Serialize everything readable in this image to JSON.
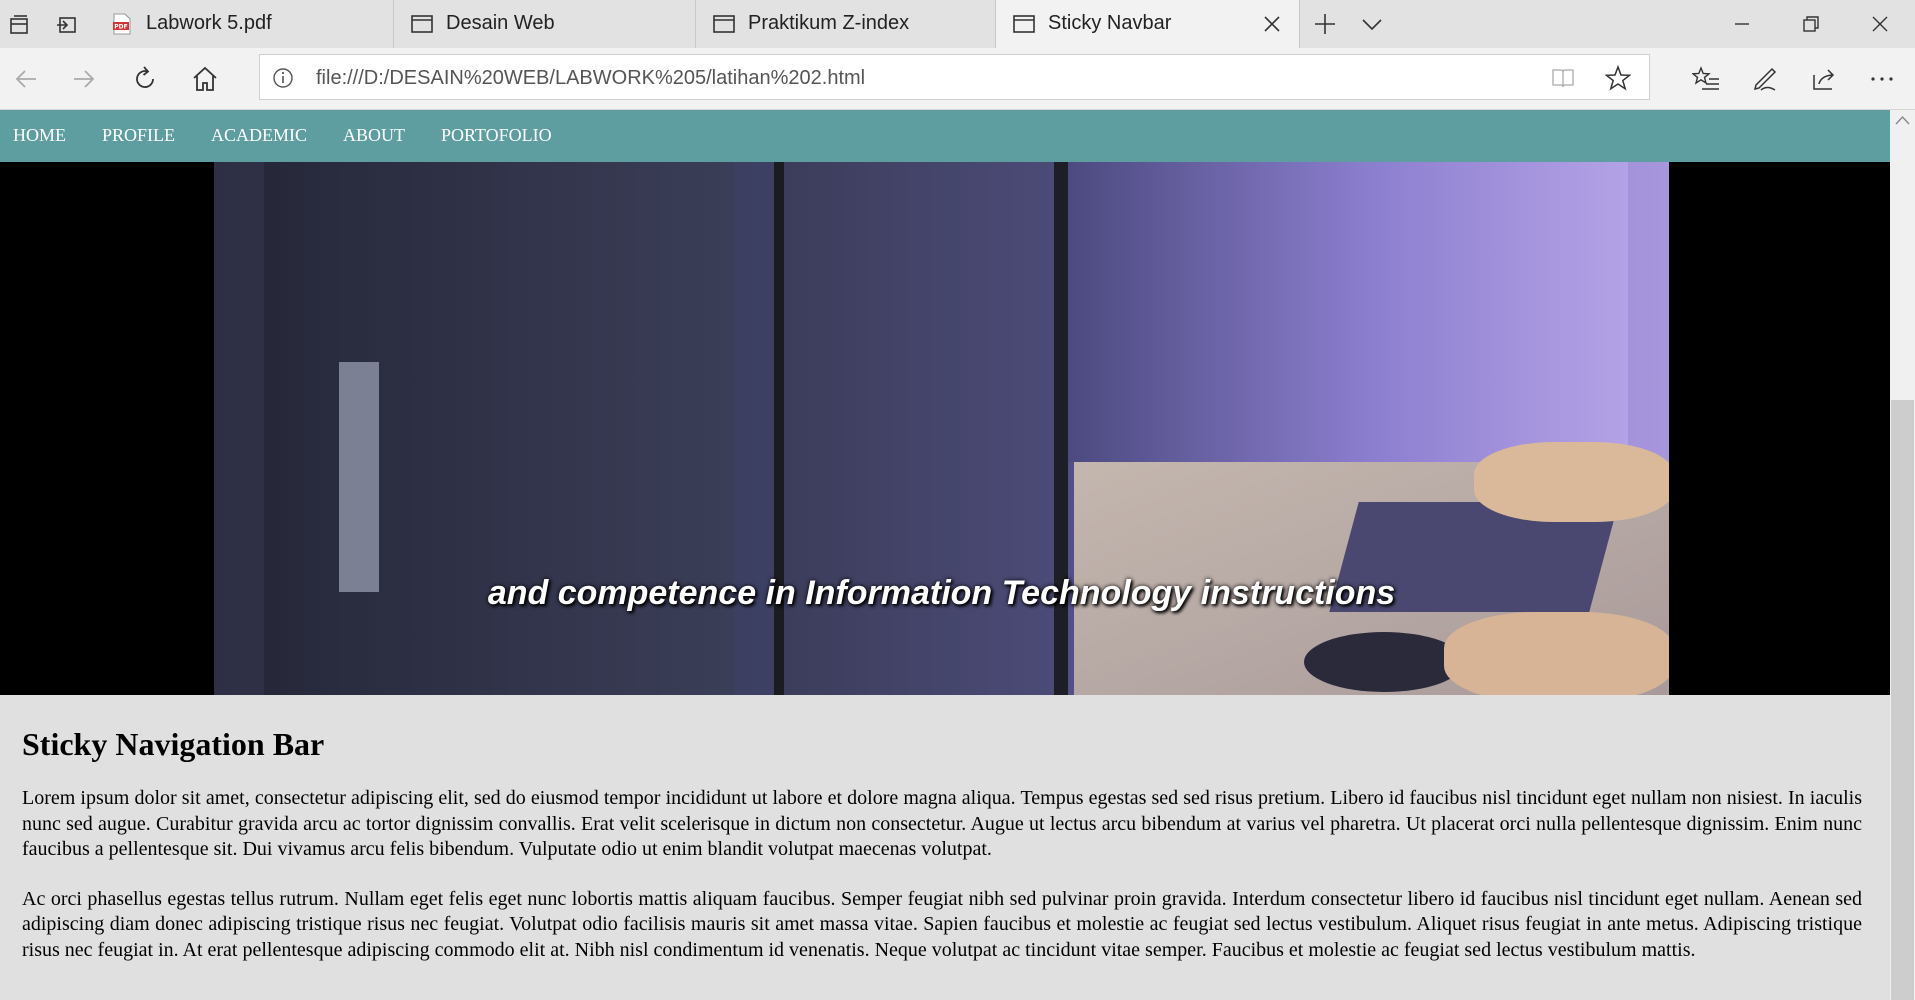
{
  "browser": {
    "tabs": [
      {
        "label": "Labwork 5.pdf",
        "icon": "pdf-icon",
        "active": false
      },
      {
        "label": "Desain Web",
        "icon": "page-icon",
        "active": false
      },
      {
        "label": "Praktikum Z-index",
        "icon": "page-icon",
        "active": false
      },
      {
        "label": "Sticky Navbar",
        "icon": "page-icon",
        "active": true
      }
    ],
    "address": {
      "url": "file:///D:/DESAIN%20WEB/LABWORK%205/latihan%202.html"
    },
    "accent_pdf": "#d13438"
  },
  "page": {
    "nav": {
      "color": "#5f9ea0",
      "links": [
        "HOME",
        "PROFILE",
        "ACADEMIC",
        "ABOUT",
        "PORTOFOLIO"
      ]
    },
    "video": {
      "caption": "and competence in Information Technology instructions"
    },
    "heading": "Sticky Navigation Bar",
    "paragraphs": [
      "Lorem ipsum dolor sit amet, consectetur adipiscing elit, sed do eiusmod tempor incididunt ut labore et dolore magna aliqua. Tempus egestas sed sed risus pretium. Libero id faucibus nisl tincidunt eget nullam non nisiest. In iaculis nunc sed augue. Curabitur gravida arcu ac tortor dignissim convallis. Erat velit scelerisque in dictum non consectetur. Augue ut lectus arcu bibendum at varius vel pharetra. Ut placerat orci nulla pellentesque dignissim. Enim nunc faucibus a pellentesque sit. Dui vivamus arcu felis bibendum. Vulputate odio ut enim blandit volutpat maecenas volutpat.",
      "Ac orci phasellus egestas tellus rutrum. Nullam eget felis eget nunc lobortis mattis aliquam faucibus. Semper feugiat nibh sed pulvinar proin gravida. Interdum consectetur libero id faucibus nisl tincidunt eget nullam. Aenean sed adipiscing diam donec adipiscing tristique risus nec feugiat. Volutpat odio facilisis mauris sit amet massa vitae. Sapien faucibus et molestie ac feugiat sed lectus vestibulum. Aliquet risus feugiat in ante metus. Adipiscing tristique risus nec feugiat in. At erat pellentesque adipiscing commodo elit at. Nibh nisl condimentum id venenatis. Neque volutpat ac tincidunt vitae semper. Faucibus et molestie ac feugiat sed lectus vestibulum mattis."
    ]
  }
}
